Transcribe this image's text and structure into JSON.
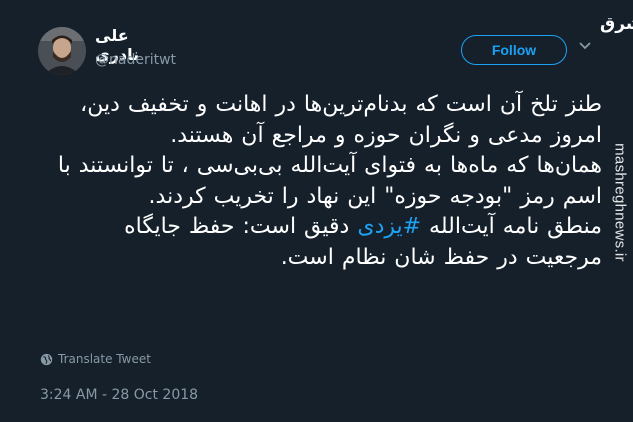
{
  "author": {
    "display_name": "علی نادری",
    "handle": "@naderitwt"
  },
  "follow_label": "Follow",
  "tweet": {
    "p1": "طنز تلخ آن است که بدنام‌ترین‌ها در اهانت و تخفیف دین، امروز مدعی و نگران حوزه و مراجع آن هستند.",
    "p2": "همان‌ها که ماه‌ها به فتوای آیت‌الله بی‌بی‌سی ، تا توانستند با اسم رمز \"بودجه حوزه\" این نهاد را تخریب کردند.",
    "p3_before": "منطق نامه آیت‌الله ",
    "hashtag": "#یزدی",
    "p3_after": " دقیق است: حفظ جایگاه مرجعیت در حفظ شان نظام است."
  },
  "translate_label": "Translate Tweet",
  "timestamp": "3:24 AM - 28 Oct 2018",
  "watermark": {
    "logo": "مشرق",
    "url": "mashreghnews.ir"
  },
  "colors": {
    "background": "#15202b",
    "accent": "#1da1f2",
    "secondary_text": "#8899a6"
  }
}
